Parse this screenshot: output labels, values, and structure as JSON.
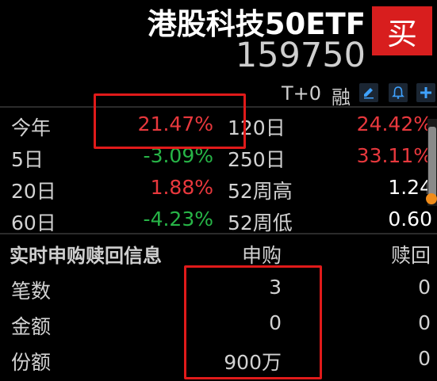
{
  "header": {
    "name": "港股科技50ETF",
    "code": "159750",
    "buy_label": "买",
    "trade_mode": "T+0",
    "margin_label": "融"
  },
  "icons": [
    "edit-icon",
    "bell-icon",
    "add-icon"
  ],
  "colors": {
    "up": "#e8383d",
    "down": "#27b547",
    "buy_button": "#d81e1e",
    "highlight_box": "#e01a1a"
  },
  "returns": {
    "rows": [
      {
        "left_label": "今年",
        "left_value": "21.47%",
        "left_color": "red",
        "right_label": "120日",
        "right_value": "24.42%",
        "right_color": "red"
      },
      {
        "left_label": "5日",
        "left_value": "-3.09%",
        "left_color": "green",
        "right_label": "250日",
        "right_value": "33.11%",
        "right_color": "red"
      },
      {
        "left_label": "20日",
        "left_value": "1.88%",
        "left_color": "red",
        "right_label": "52周高",
        "right_value": "1.24",
        "right_color": "white"
      },
      {
        "left_label": "60日",
        "left_value": "-4.23%",
        "left_color": "green",
        "right_label": "52周低",
        "right_value": "0.60",
        "right_color": "white"
      }
    ]
  },
  "subscription": {
    "title": "实时申购赎回信息",
    "col_subscribe": "申购",
    "col_redeem": "赎回",
    "rows": [
      {
        "label": "笔数",
        "subscribe": "3",
        "redeem": "0"
      },
      {
        "label": "金额",
        "subscribe": "0",
        "redeem": "0"
      },
      {
        "label": "份额",
        "subscribe": "900万",
        "redeem": "0"
      }
    ]
  }
}
